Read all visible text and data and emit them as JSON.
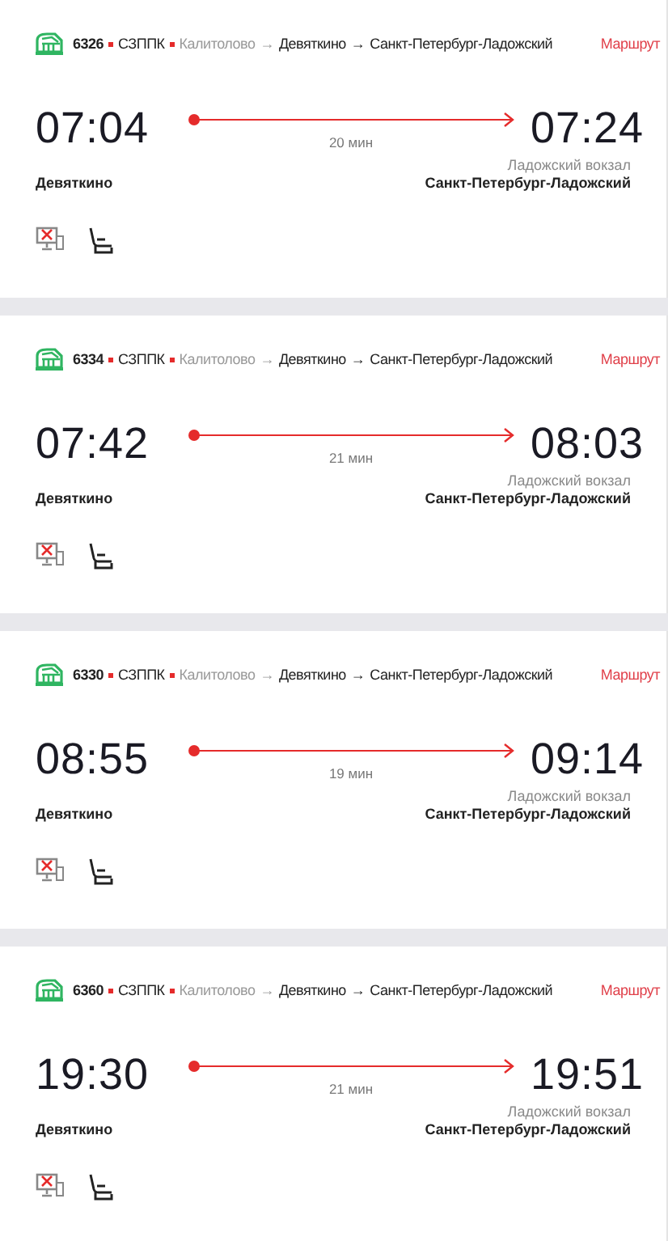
{
  "trains": [
    {
      "number": "6326",
      "carrier": "СЗППК",
      "origin": "Калитолово",
      "arrow_1": "→",
      "via": "Девяткино",
      "arrow_2": "→",
      "destination": "Санкт-Петербург-Ладожский",
      "route_link": "Маршрут",
      "departure_time": "07:04",
      "duration": "20 мин",
      "arrival_time": "07:24",
      "departure_station": "Девяткино",
      "arrival_note": "Ладожский вокзал",
      "arrival_station": "Санкт-Петербург-Ладожский"
    },
    {
      "number": "6334",
      "carrier": "СЗППК",
      "origin": "Калитолово",
      "arrow_1": "→",
      "via": "Девяткино",
      "arrow_2": "→",
      "destination": "Санкт-Петербург-Ладожский",
      "route_link": "Маршрут",
      "departure_time": "07:42",
      "duration": "21 мин",
      "arrival_time": "08:03",
      "departure_station": "Девяткино",
      "arrival_note": "Ладожский вокзал",
      "arrival_station": "Санкт-Петербург-Ладожский"
    },
    {
      "number": "6330",
      "carrier": "СЗППК",
      "origin": "Калитолово",
      "arrow_1": "→",
      "via": "Девяткино",
      "arrow_2": "→",
      "destination": "Санкт-Петербург-Ладожский",
      "route_link": "Маршрут",
      "departure_time": "08:55",
      "duration": "19 мин",
      "arrival_time": "09:14",
      "departure_station": "Девяткино",
      "arrival_note": "Ладожский вокзал",
      "arrival_station": "Санкт-Петербург-Ладожский"
    },
    {
      "number": "6360",
      "carrier": "СЗППК",
      "origin": "Калитолово",
      "arrow_1": "→",
      "via": "Девяткино",
      "arrow_2": "→",
      "destination": "Санкт-Петербург-Ладожский",
      "route_link": "Маршрут",
      "departure_time": "19:30",
      "duration": "21 мин",
      "arrival_time": "19:51",
      "departure_station": "Девяткино",
      "arrival_note": "Ладожский вокзал",
      "arrival_station": "Санкт-Петербург-Ладожский"
    }
  ]
}
